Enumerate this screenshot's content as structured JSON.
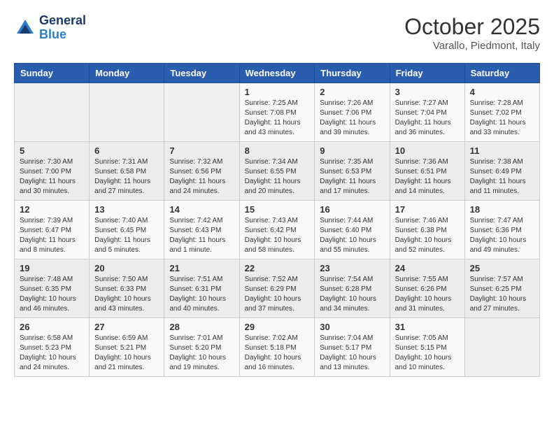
{
  "header": {
    "logo_line1": "General",
    "logo_line2": "Blue",
    "month_year": "October 2025",
    "location": "Varallo, Piedmont, Italy"
  },
  "weekdays": [
    "Sunday",
    "Monday",
    "Tuesday",
    "Wednesday",
    "Thursday",
    "Friday",
    "Saturday"
  ],
  "weeks": [
    [
      {
        "day": "",
        "content": ""
      },
      {
        "day": "",
        "content": ""
      },
      {
        "day": "",
        "content": ""
      },
      {
        "day": "1",
        "content": "Sunrise: 7:25 AM\nSunset: 7:08 PM\nDaylight: 11 hours\nand 43 minutes."
      },
      {
        "day": "2",
        "content": "Sunrise: 7:26 AM\nSunset: 7:06 PM\nDaylight: 11 hours\nand 39 minutes."
      },
      {
        "day": "3",
        "content": "Sunrise: 7:27 AM\nSunset: 7:04 PM\nDaylight: 11 hours\nand 36 minutes."
      },
      {
        "day": "4",
        "content": "Sunrise: 7:28 AM\nSunset: 7:02 PM\nDaylight: 11 hours\nand 33 minutes."
      }
    ],
    [
      {
        "day": "5",
        "content": "Sunrise: 7:30 AM\nSunset: 7:00 PM\nDaylight: 11 hours\nand 30 minutes."
      },
      {
        "day": "6",
        "content": "Sunrise: 7:31 AM\nSunset: 6:58 PM\nDaylight: 11 hours\nand 27 minutes."
      },
      {
        "day": "7",
        "content": "Sunrise: 7:32 AM\nSunset: 6:56 PM\nDaylight: 11 hours\nand 24 minutes."
      },
      {
        "day": "8",
        "content": "Sunrise: 7:34 AM\nSunset: 6:55 PM\nDaylight: 11 hours\nand 20 minutes."
      },
      {
        "day": "9",
        "content": "Sunrise: 7:35 AM\nSunset: 6:53 PM\nDaylight: 11 hours\nand 17 minutes."
      },
      {
        "day": "10",
        "content": "Sunrise: 7:36 AM\nSunset: 6:51 PM\nDaylight: 11 hours\nand 14 minutes."
      },
      {
        "day": "11",
        "content": "Sunrise: 7:38 AM\nSunset: 6:49 PM\nDaylight: 11 hours\nand 11 minutes."
      }
    ],
    [
      {
        "day": "12",
        "content": "Sunrise: 7:39 AM\nSunset: 6:47 PM\nDaylight: 11 hours\nand 8 minutes."
      },
      {
        "day": "13",
        "content": "Sunrise: 7:40 AM\nSunset: 6:45 PM\nDaylight: 11 hours\nand 5 minutes."
      },
      {
        "day": "14",
        "content": "Sunrise: 7:42 AM\nSunset: 6:43 PM\nDaylight: 11 hours\nand 1 minute."
      },
      {
        "day": "15",
        "content": "Sunrise: 7:43 AM\nSunset: 6:42 PM\nDaylight: 10 hours\nand 58 minutes."
      },
      {
        "day": "16",
        "content": "Sunrise: 7:44 AM\nSunset: 6:40 PM\nDaylight: 10 hours\nand 55 minutes."
      },
      {
        "day": "17",
        "content": "Sunrise: 7:46 AM\nSunset: 6:38 PM\nDaylight: 10 hours\nand 52 minutes."
      },
      {
        "day": "18",
        "content": "Sunrise: 7:47 AM\nSunset: 6:36 PM\nDaylight: 10 hours\nand 49 minutes."
      }
    ],
    [
      {
        "day": "19",
        "content": "Sunrise: 7:48 AM\nSunset: 6:35 PM\nDaylight: 10 hours\nand 46 minutes."
      },
      {
        "day": "20",
        "content": "Sunrise: 7:50 AM\nSunset: 6:33 PM\nDaylight: 10 hours\nand 43 minutes."
      },
      {
        "day": "21",
        "content": "Sunrise: 7:51 AM\nSunset: 6:31 PM\nDaylight: 10 hours\nand 40 minutes."
      },
      {
        "day": "22",
        "content": "Sunrise: 7:52 AM\nSunset: 6:29 PM\nDaylight: 10 hours\nand 37 minutes."
      },
      {
        "day": "23",
        "content": "Sunrise: 7:54 AM\nSunset: 6:28 PM\nDaylight: 10 hours\nand 34 minutes."
      },
      {
        "day": "24",
        "content": "Sunrise: 7:55 AM\nSunset: 6:26 PM\nDaylight: 10 hours\nand 31 minutes."
      },
      {
        "day": "25",
        "content": "Sunrise: 7:57 AM\nSunset: 6:25 PM\nDaylight: 10 hours\nand 27 minutes."
      }
    ],
    [
      {
        "day": "26",
        "content": "Sunrise: 6:58 AM\nSunset: 5:23 PM\nDaylight: 10 hours\nand 24 minutes."
      },
      {
        "day": "27",
        "content": "Sunrise: 6:59 AM\nSunset: 5:21 PM\nDaylight: 10 hours\nand 21 minutes."
      },
      {
        "day": "28",
        "content": "Sunrise: 7:01 AM\nSunset: 5:20 PM\nDaylight: 10 hours\nand 19 minutes."
      },
      {
        "day": "29",
        "content": "Sunrise: 7:02 AM\nSunset: 5:18 PM\nDaylight: 10 hours\nand 16 minutes."
      },
      {
        "day": "30",
        "content": "Sunrise: 7:04 AM\nSunset: 5:17 PM\nDaylight: 10 hours\nand 13 minutes."
      },
      {
        "day": "31",
        "content": "Sunrise: 7:05 AM\nSunset: 5:15 PM\nDaylight: 10 hours\nand 10 minutes."
      },
      {
        "day": "",
        "content": ""
      }
    ]
  ]
}
